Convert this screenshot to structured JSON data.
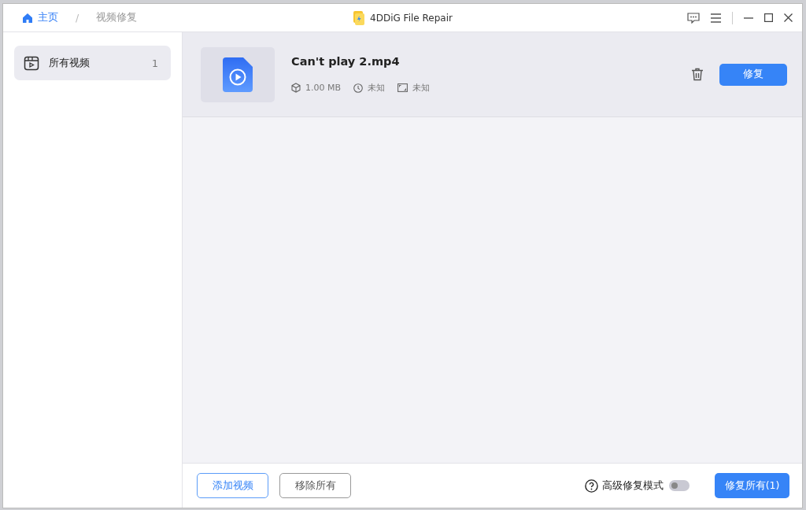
{
  "window": {
    "breadcrumb_separator": "/",
    "breadcrumb": [
      {
        "label": "主页",
        "kind": "home"
      },
      {
        "label": "视频修复",
        "kind": "current"
      }
    ],
    "title": "4DDiG File Repair"
  },
  "sidebar": {
    "items": [
      {
        "label": "所有视频",
        "count": "1",
        "selected": true
      }
    ]
  },
  "files": [
    {
      "name": "Can't play 2.mp4",
      "size": "1.00 MB",
      "duration": "未知",
      "resolution": "未知",
      "action": "修复"
    }
  ],
  "footer": {
    "add_button": "添加视频",
    "remove_button": "移除所有",
    "advanced_mode": {
      "label": "高级修复模式",
      "on": false
    },
    "repair_all_button": "修复所有(1)"
  }
}
